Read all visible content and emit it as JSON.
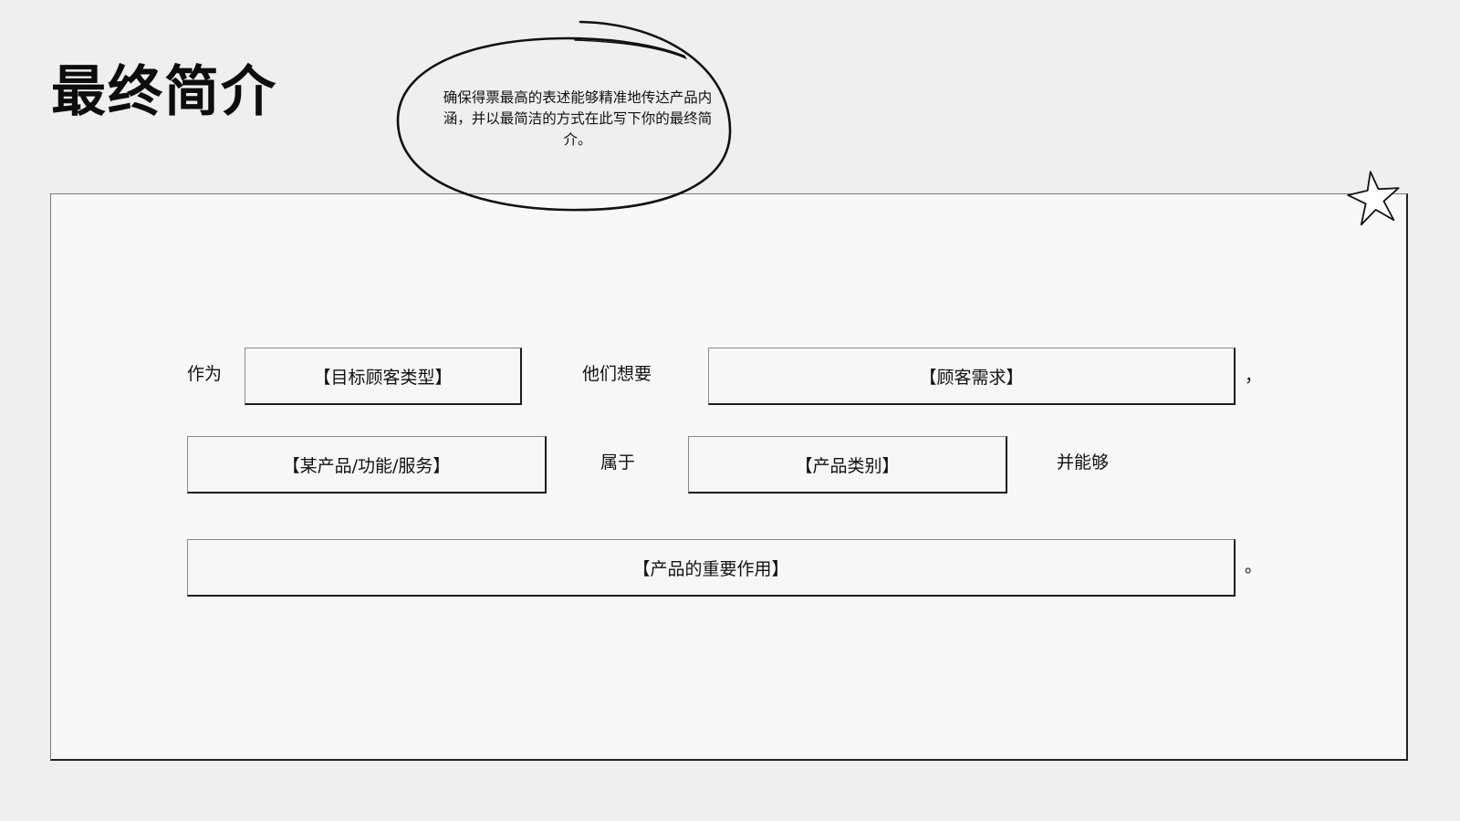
{
  "page": {
    "title": "最终简介",
    "bubble_text": "确保得票最高的表述能够精准地传达产品内涵，并以最简洁的方式在此写下你的最终简介。"
  },
  "sentence": {
    "word_as": "作为",
    "field_customer_type": "【目标顾客类型】",
    "word_they_want": "他们想要",
    "field_customer_need": "【顾客需求】",
    "comma": "，",
    "field_product": "【某产品/功能/服务】",
    "word_belongs_to": "属于",
    "field_category": "【产品类别】",
    "word_and_can": "并能够",
    "field_key_benefit": "【产品的重要作用】",
    "period": "。"
  },
  "icons": {
    "bubble": "hand-drawn-ellipse-icon",
    "star": "star-icon"
  },
  "colors": {
    "background": "#efefef",
    "panel": "#f8f8f8",
    "ink": "#111111"
  }
}
